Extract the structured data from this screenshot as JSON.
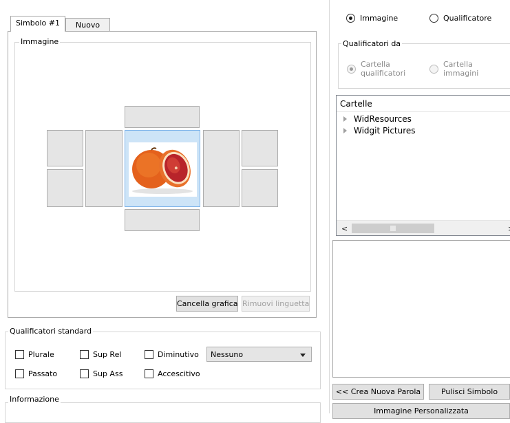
{
  "tabs": {
    "symbol": "Simbolo #1",
    "new": "Nuovo"
  },
  "image_group": {
    "legend": "Immagine"
  },
  "buttons": {
    "clear_graphic": "Cancella grafica",
    "remove_tab": "Rimuovi linguetta",
    "new_word": "<< Crea Nuova Parola",
    "clear_symbol": "Pulisci Simbolo",
    "custom_image": "Immagine Personalizzata"
  },
  "standard_qualifiers": {
    "legend": "Qualificatori standard",
    "plural": "Plurale",
    "sup_rel": "Sup Rel",
    "diminutive": "Diminutivo",
    "past": "Passato",
    "sup_ass": "Sup Ass",
    "augmentative": "Accescitivo",
    "dropdown_value": "Nessuno"
  },
  "info": {
    "legend": "Informazione"
  },
  "mode": {
    "image": "Immagine",
    "qualifier": "Qualificatore",
    "selected": "Immagine"
  },
  "qualifiers_from": {
    "legend": "Qualificatori da",
    "opt1_line1": "Cartella",
    "opt1_line2": "qualificatori",
    "opt2_line1": "Cartella",
    "opt2_line2": "immagini"
  },
  "folders": {
    "header": "Cartelle",
    "items": [
      "WidResources",
      "Widgit Pictures"
    ]
  },
  "icons": {
    "expand": "chevron-right-icon",
    "scroll_left": "scroll-left-arrow-icon",
    "scroll_right": "scroll-right-arrow-icon",
    "dropdown": "chevron-down-icon",
    "image": "blood-orange-image"
  }
}
